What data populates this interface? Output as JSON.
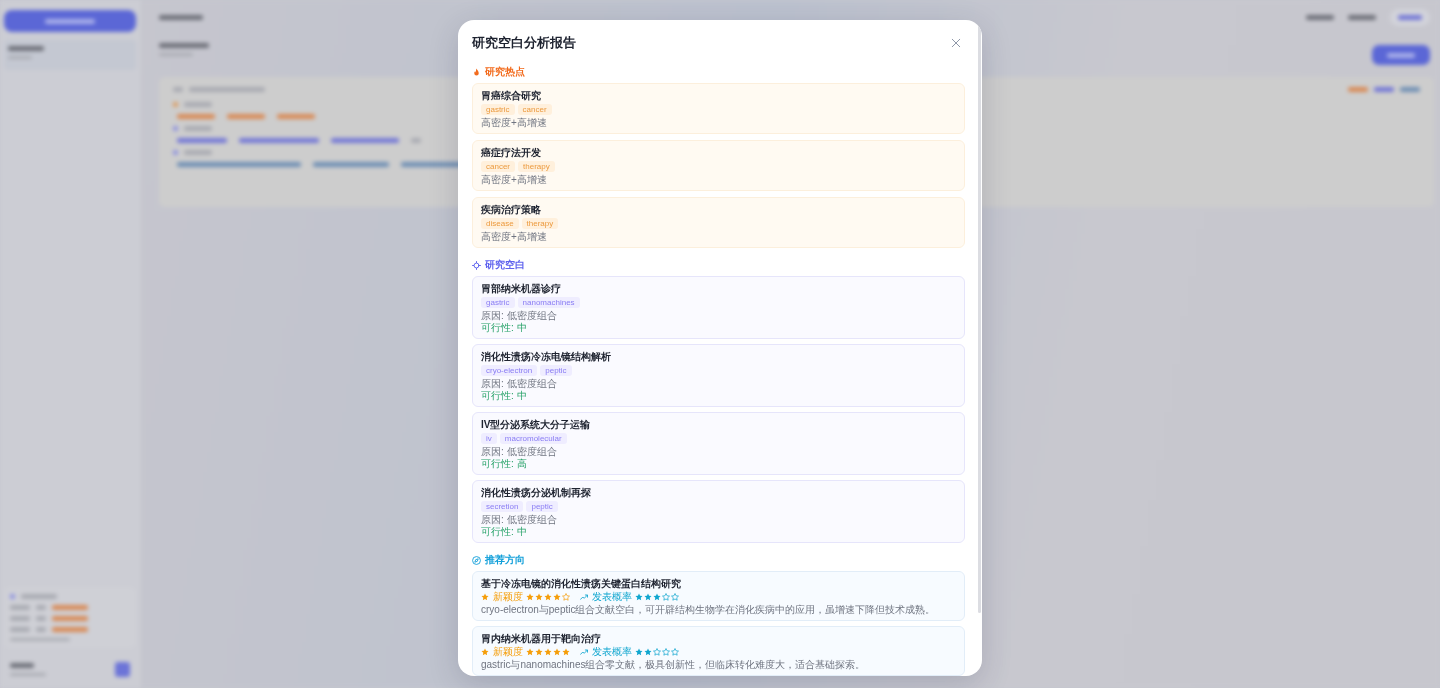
{
  "backdrop": {
    "blurred": true
  },
  "dialog": {
    "title": "研究空白分析报告",
    "sections": [
      {
        "kind": "hotspots",
        "title": "研究热点",
        "items": [
          {
            "title": "胃癌综合研究",
            "tags": [
              "gastric",
              "cancer"
            ],
            "note": "高密度+高增速"
          },
          {
            "title": "癌症疗法开发",
            "tags": [
              "cancer",
              "therapy"
            ],
            "note": "高密度+高增速"
          },
          {
            "title": "疾病治疗策略",
            "tags": [
              "disease",
              "therapy"
            ],
            "note": "高密度+高增速"
          }
        ]
      },
      {
        "kind": "gaps",
        "title": "研究空白",
        "items": [
          {
            "title": "胃部纳米机器诊疗",
            "tags": [
              "gastric",
              "nanomachines"
            ],
            "reason": "原因: 低密度组合",
            "feasibility": "可行性: 中"
          },
          {
            "title": "消化性溃疡冷冻电镜结构解析",
            "tags": [
              "cryo-electron",
              "peptic"
            ],
            "reason": "原因: 低密度组合",
            "feasibility": "可行性: 中"
          },
          {
            "title": "IV型分泌系统大分子运输",
            "tags": [
              "iv",
              "macromolecular"
            ],
            "reason": "原因: 低密度组合",
            "feasibility": "可行性: 高"
          },
          {
            "title": "消化性溃疡分泌机制再探",
            "tags": [
              "secretion",
              "peptic"
            ],
            "reason": "原因: 低密度组合",
            "feasibility": "可行性: 中"
          }
        ]
      },
      {
        "kind": "recommendations",
        "title": "推荐方向",
        "items": [
          {
            "title": "基于冷冻电镜的消化性溃疡关键蛋白结构研究",
            "ratings": [
              {
                "kind": "novelty",
                "label": "新颖度",
                "stars": 4
              },
              {
                "kind": "probability",
                "label": "发表概率",
                "stars": 3
              }
            ],
            "description": "cryo-electron与peptic组合文献空白，可开辟结构生物学在消化疾病中的应用，虽增速下降但技术成熟。"
          },
          {
            "title": "胃内纳米机器用于靶向治疗",
            "ratings": [
              {
                "kind": "novelty",
                "label": "新颖度",
                "stars": 5
              },
              {
                "kind": "probability",
                "label": "发表概率",
                "stars": 2
              }
            ],
            "description": "gastric与nanomachines组合零文献，极具创新性，但临床转化难度大，适合基础探索。"
          }
        ]
      }
    ]
  }
}
